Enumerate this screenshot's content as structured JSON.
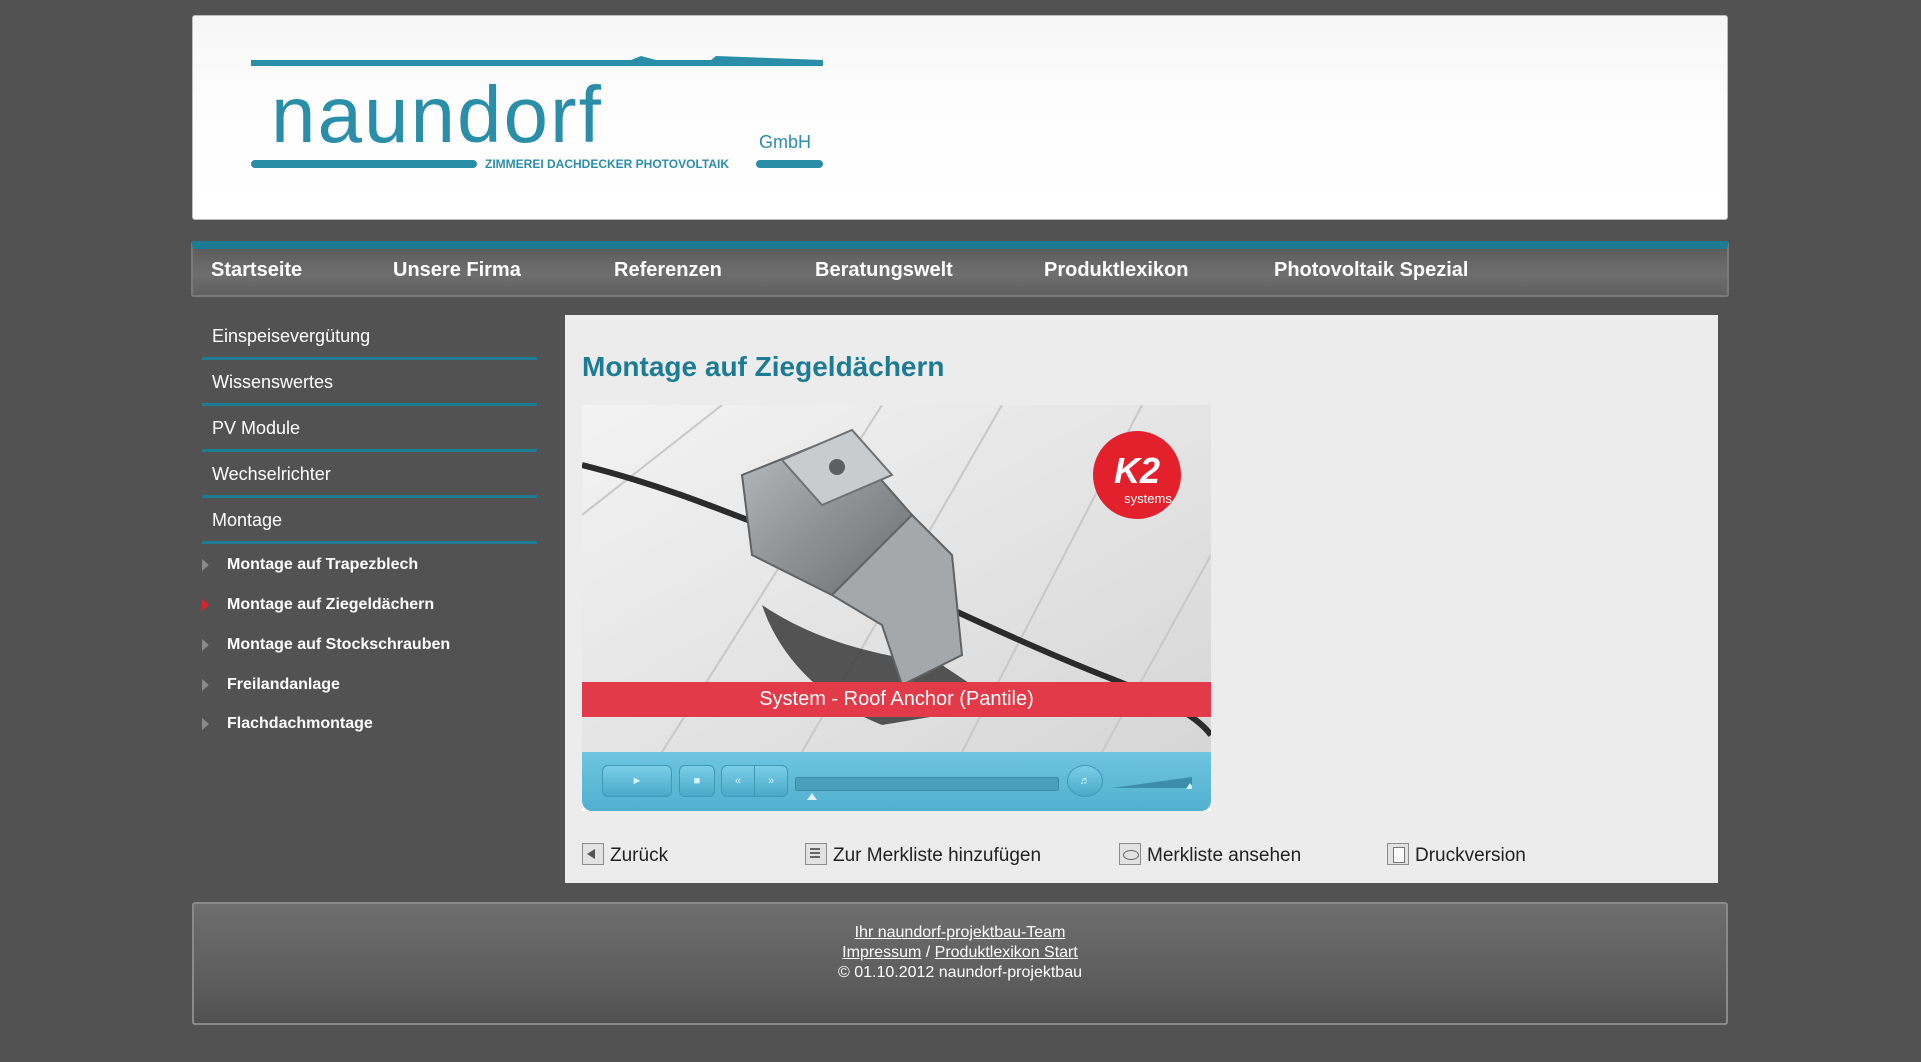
{
  "header": {
    "logo_name": "naundorf",
    "logo_suffix": "GmbH",
    "logo_tagline": "ZIMMEREI  DACHDECKER  PHOTOVOLTAIK"
  },
  "nav": {
    "items": [
      "Startseite",
      "Unsere Firma",
      "Referenzen",
      "Beratungswelt",
      "Produktlexikon",
      "Photovoltaik Spezial"
    ]
  },
  "sidebar": {
    "items": [
      "Einspeisevergütung",
      "Wissenswertes",
      "PV Module",
      "Wechselrichter",
      "Montage"
    ],
    "subitems": [
      "Montage auf Trapezblech",
      "Montage auf Ziegeldächern",
      "Montage auf Stockschrauben",
      "Freilandanlage",
      "Flachdachmontage"
    ],
    "active_subitem": "Montage auf Ziegeldächern"
  },
  "content": {
    "title": "Montage auf Ziegeldächern",
    "video": {
      "caption": "System - Roof Anchor (Pantile)",
      "brand_badge": "K2",
      "brand_badge_sub": "systems"
    },
    "actions": {
      "back": "Zurück",
      "add_to_list": "Zur Merkliste hinzufügen",
      "view_list": "Merkliste ansehen",
      "print": "Druckversion"
    }
  },
  "footer": {
    "team_link": "Ihr naundorf-projektbau-Team",
    "impressum": "Impressum",
    "separator": " / ",
    "lexikon_start": "Produktlexikon Start",
    "copyright": "© 01.10.2012 naundorf-projektbau"
  },
  "colors": {
    "accent": "#1d7c94",
    "background": "#525252",
    "active_marker": "#e0202a",
    "caption_band": "#e23a48"
  }
}
